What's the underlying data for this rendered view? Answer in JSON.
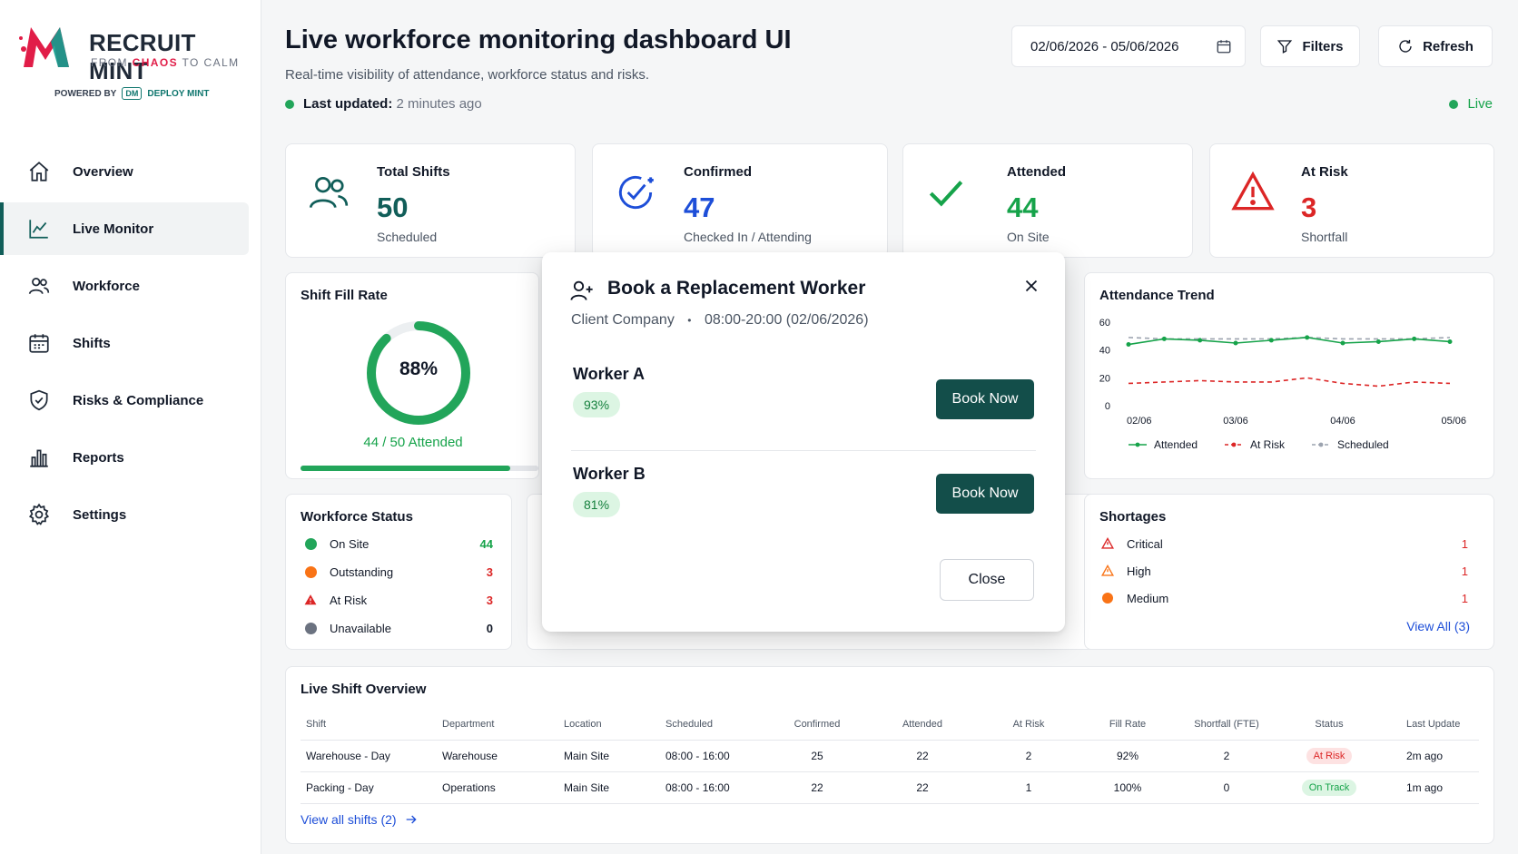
{
  "brand": {
    "name": "RECRUIT MINT",
    "tagline_prefix": "FROM",
    "tagline_highlight": "CHAOS",
    "tagline_suffix": "TO CALM",
    "powered_by": "POWERED BY",
    "dm_badge": "DM",
    "dm_name": "DEPLOY MINT"
  },
  "nav": [
    {
      "label": "Overview",
      "icon": "home-icon"
    },
    {
      "label": "Live Monitor",
      "icon": "chart-line-icon",
      "active": true
    },
    {
      "label": "Workforce",
      "icon": "users-icon"
    },
    {
      "label": "Shifts",
      "icon": "calendar-icon"
    },
    {
      "label": "Risks & Compliance",
      "icon": "shield-icon"
    },
    {
      "label": "Reports",
      "icon": "bar-chart-icon"
    },
    {
      "label": "Settings",
      "icon": "gear-icon"
    }
  ],
  "header": {
    "title": "Live workforce monitoring dashboard UI",
    "subtitle": "Real-time visibility of attendance, workforce status and risks.",
    "last_updated_label": "Last updated:",
    "last_updated_value": "2 minutes ago",
    "date_range": "02/06/2026 - 05/06/2026",
    "filters_label": "Filters",
    "refresh_label": "Refresh",
    "live_label": "Live"
  },
  "stats": [
    {
      "title": "Total Shifts",
      "value": "50",
      "sub": "Scheduled",
      "color": "#115e59",
      "icon": "users-icon"
    },
    {
      "title": "Confirmed",
      "value": "47",
      "sub": "Checked In / Attending",
      "color": "#1d4ed8",
      "icon": "check-circle-icon"
    },
    {
      "title": "Attended",
      "value": "44",
      "sub": "On Site",
      "color": "#16a34a",
      "icon": "check-icon"
    },
    {
      "title": "At Risk",
      "value": "3",
      "sub": "Shortfall",
      "color": "#dc2626",
      "icon": "warning-icon"
    }
  ],
  "fill_rate": {
    "title": "Shift Fill Rate",
    "percent_label": "88%",
    "percent": 88,
    "attended_text": "44 / 50 Attended"
  },
  "workforce_status": {
    "title": "Workforce Status",
    "rows": [
      {
        "label": "On Site",
        "value": "44"
      },
      {
        "label": "Outstanding",
        "value": "3"
      },
      {
        "label": "At Risk",
        "value": "3"
      },
      {
        "label": "Unavailable",
        "value": "0"
      }
    ]
  },
  "attendance_trend": {
    "title": "Attendance Trend"
  },
  "chart_data": {
    "type": "line",
    "x": [
      "02/06",
      "",
      "",
      "03/06",
      "",
      "",
      "04/06",
      "",
      "",
      "05/06"
    ],
    "tick_labels": [
      "02/06",
      "03/06",
      "04/06",
      "05/06"
    ],
    "ylim": [
      0,
      60
    ],
    "yticks": [
      0,
      20,
      40,
      60
    ],
    "series": [
      {
        "name": "Attended",
        "color": "#16a34a",
        "style": "solid",
        "values": [
          44,
          48,
          47,
          45,
          47,
          49,
          45,
          46,
          48,
          46
        ]
      },
      {
        "name": "At Risk",
        "color": "#dc2626",
        "style": "dashed",
        "values": [
          16,
          17,
          18,
          17,
          17,
          20,
          16,
          14,
          17,
          16
        ]
      },
      {
        "name": "Scheduled",
        "color": "#9ca3af",
        "style": "dashed",
        "values": [
          49,
          48,
          48,
          48,
          48,
          49,
          48,
          48,
          48,
          49
        ]
      }
    ],
    "legend": "bottom"
  },
  "shortages": {
    "title": "Shortages",
    "rows": [
      {
        "label": "Critical",
        "value": "1"
      },
      {
        "label": "High",
        "value": "1"
      },
      {
        "label": "Medium",
        "value": "1"
      }
    ],
    "view_all": "View All (3)"
  },
  "shift_overview": {
    "title": "Live Shift Overview",
    "columns": [
      "Shift",
      "Department",
      "Location",
      "Scheduled",
      "Confirmed",
      "Attended",
      "At Risk",
      "Fill Rate",
      "Shortfall (FTE)",
      "Status",
      "Last Update"
    ],
    "rows": [
      [
        "Warehouse - Day",
        "Warehouse",
        "Main Site",
        "08:00 - 16:00",
        "25",
        "22",
        "2",
        "92%",
        "2",
        "At Risk",
        "2m ago"
      ],
      [
        "Packing - Day",
        "Operations",
        "Main Site",
        "08:00 - 16:00",
        "22",
        "22",
        "1",
        "100%",
        "0",
        "On Track",
        "1m ago"
      ]
    ],
    "view_all": "View all shifts (2)"
  },
  "modal": {
    "title": "Book a Replacement Worker",
    "company": "Client Company",
    "separator": "•",
    "shift_time": "08:00-20:00 (02/06/2026)",
    "workers": [
      {
        "name": "Worker A",
        "match": "93%",
        "button": "Book Now"
      },
      {
        "name": "Worker B",
        "match": "81%",
        "button": "Book Now"
      }
    ],
    "close_label": "Close"
  }
}
